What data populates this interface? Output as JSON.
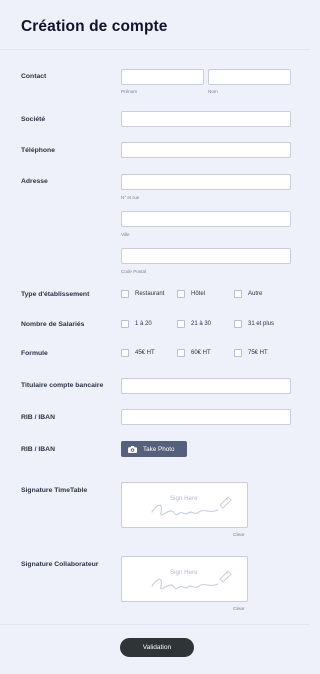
{
  "title": "Création de compte",
  "fields": {
    "contact": {
      "label": "Contact",
      "first": "Prénom",
      "last": "Nom"
    },
    "societe": {
      "label": "Société"
    },
    "telephone": {
      "label": "Téléphone"
    },
    "adresse": {
      "label": "Adresse",
      "street": "N° et rue",
      "city": "Ville",
      "postal": "Code Postal"
    },
    "type": {
      "label": "Type d'établissement",
      "options": [
        "Restaurant",
        "Hôtel",
        "Autre"
      ]
    },
    "salaries": {
      "label": "Nombre de Salariés",
      "options": [
        "1 à 20",
        "21 à 30",
        "31 et plus"
      ]
    },
    "formule": {
      "label": "Formule",
      "options": [
        "45€ HT",
        "60€ HT",
        "75€ HT"
      ]
    },
    "titulaire": {
      "label": "Titulaire compte bancaire"
    },
    "rib1": {
      "label": "RIB / IBAN"
    },
    "rib2": {
      "label": "RIB / IBAN",
      "button": "Take Photo"
    },
    "sig1": {
      "label": "Signature TimeTable",
      "placeholder": "Sign Here",
      "clear": "Clear"
    },
    "sig2": {
      "label": "Signature Collaborateur",
      "placeholder": "Sign Here",
      "clear": "Clear"
    }
  },
  "submit": "Validation",
  "colors": {
    "background": "#eef0fa",
    "button": "#2f3437",
    "photo_button": "#56607a"
  }
}
